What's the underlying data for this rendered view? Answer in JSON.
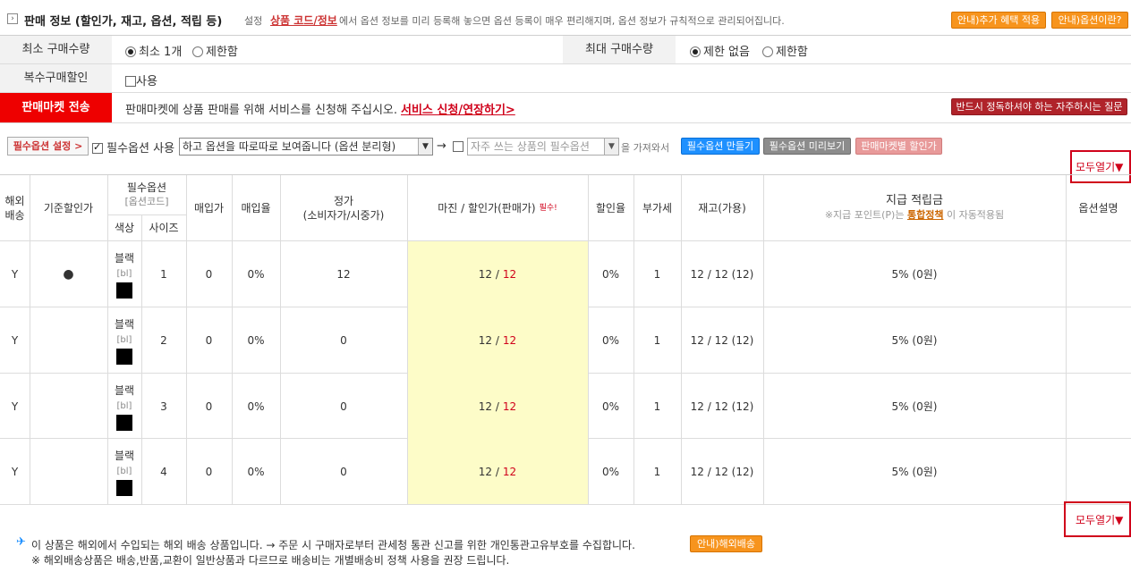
{
  "header": {
    "title": "판매 정보 (할인가, 재고, 옵션, 적립 등)",
    "setting_word": "설정",
    "link": "상품 코드/정보",
    "description": "에서 옵션 정보를 미리 등록해 놓으면 옵션 등록이 매우 편리해지며, 옵션 정보가 규칙적으로 관리되어집니다.",
    "btn_extra_benefit": "안내)추가 혜택 적용",
    "btn_what_option": "안내)옵션이란?"
  },
  "form": {
    "min_qty_label": "최소 구매수량",
    "min_qty_opt1": "최소 1개",
    "min_qty_opt2": "제한함",
    "max_qty_label": "최대 구매수량",
    "max_qty_opt1": "제한 없음",
    "max_qty_opt2": "제한함",
    "multi_discount_label": "복수구매할인",
    "multi_discount_check": "사용",
    "market_label": "판매마켓 전송",
    "market_text": "판매마켓에 상품 판매를 위해 서비스를 신청해 주십시오.",
    "market_link": "서비스 신청/연장하기>",
    "market_faq_btn": "반드시 정독하셔야 하는 자주하시는 질문"
  },
  "options_bar": {
    "setting_btn": "필수옵션 설정 >",
    "use_label": "필수옵션 사용",
    "mode_select": "하고 옵션을 따로따로 보여줍니다 (옵션 분리형)",
    "arrow": "→",
    "frequent_select": "자주 쓰는 상품의 필수옵션",
    "fetch_text": "을 가져와서",
    "make_btn": "필수옵션 만들기",
    "preview_btn": "필수옵션 미리보기",
    "market_discount_btn": "판매마켓별 할인가",
    "expand_all": "모두열기▼"
  },
  "table": {
    "headers": {
      "overseas": "해외\n배송",
      "base_discount": "기준할인가",
      "req_option": "필수옵션",
      "option_code": "[옵션코드]",
      "color": "색상",
      "size": "사이즈",
      "purchase_price": "매입가",
      "purchase_rate": "매입율",
      "list_price": "정가\n(소비자가/시중가)",
      "margin": "마진 / 할인가(판매가)",
      "required_mark": "필수!",
      "discount_rate": "할인율",
      "vat": "부가세",
      "stock": "재고(가용)",
      "points": "지급 적립금",
      "points_note_pre": "※지급 포인트(P)는",
      "points_note_link": "통합정책",
      "points_note_post": "이 자동적용됨",
      "option_desc": "옵션설명"
    },
    "rows": [
      {
        "overseas": "Y",
        "base": "●",
        "color_name": "블랙",
        "color_code": "[bl]",
        "size": "1",
        "purchase": "0",
        "rate": "0%",
        "list_price": "12",
        "margin": "12 /",
        "sale": "12",
        "discount": "0%",
        "vat": "1",
        "stock": "12 / 12 (12)",
        "points": "5% (0원)"
      },
      {
        "overseas": "Y",
        "base": "",
        "color_name": "블랙",
        "color_code": "[bl]",
        "size": "2",
        "purchase": "0",
        "rate": "0%",
        "list_price": "0",
        "margin": "12 /",
        "sale": "12",
        "discount": "0%",
        "vat": "1",
        "stock": "12 / 12 (12)",
        "points": "5% (0원)"
      },
      {
        "overseas": "Y",
        "base": "",
        "color_name": "블랙",
        "color_code": "[bl]",
        "size": "3",
        "purchase": "0",
        "rate": "0%",
        "list_price": "0",
        "margin": "12 /",
        "sale": "12",
        "discount": "0%",
        "vat": "1",
        "stock": "12 / 12 (12)",
        "points": "5% (0원)"
      },
      {
        "overseas": "Y",
        "base": "",
        "color_name": "블랙",
        "color_code": "[bl]",
        "size": "4",
        "purchase": "0",
        "rate": "0%",
        "list_price": "0",
        "margin": "12 /",
        "sale": "12",
        "discount": "0%",
        "vat": "1",
        "stock": "12 / 12 (12)",
        "points": "5% (0원)"
      }
    ]
  },
  "footer": {
    "expand_all": "모두열기▼",
    "notice": "이 상품은 해외에서 수입되는 해외 배송 상품입니다. → 주문 시 구매자로부터 관세청 통관 신고를 위한 개인통관고유부호를 수집합니다.",
    "overseas_btn": "안내)해외배송",
    "notice2": "※ 해외배송상품은 배송,반품,교환이 일반상품과 다르므로 배송비는 개별배송비 정책 사용을 권장 드립니다."
  },
  "colors": {
    "accent_orange": "#f7941d",
    "market_red": "#ee0000",
    "highlight_yellow": "#fdfcc8",
    "link_red": "#d0021b"
  }
}
